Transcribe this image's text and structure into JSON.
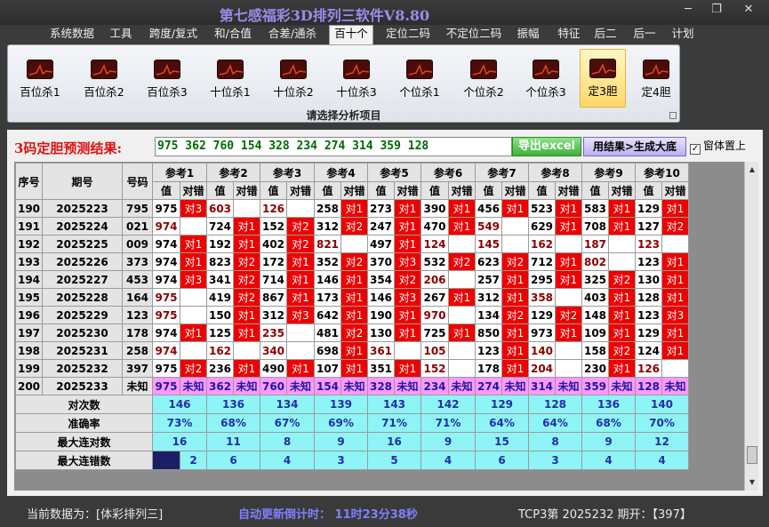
{
  "window": {
    "title": "第七感福彩3D排列三软件V8.80",
    "min": "─",
    "max": "❐",
    "close": "✕"
  },
  "menu": [
    "系统数据",
    "工具",
    "跨度/复式",
    "和/合值",
    "合差/通杀",
    "百十个",
    "定位二码",
    "不定位二码",
    "振幅",
    "特征",
    "后二",
    "后一",
    "计划"
  ],
  "menu_active": "百十个",
  "ribbon": {
    "items": [
      "百位杀1",
      "百位杀2",
      "百位杀3",
      "十位杀1",
      "十位杀2",
      "十位杀3",
      "个位杀1",
      "个位杀2",
      "个位杀3",
      "定3胆",
      "定4胆"
    ],
    "selected": "定3胆",
    "caption": "请选择分析项目"
  },
  "result": {
    "label": "3码定胆预测结果:",
    "value": "975 362 760 154 328 234 274 314 359 128",
    "excel_btn": "导出excel",
    "gen_btn": "用结果>生成大底",
    "pin_label": "窗体置上",
    "pin_checked": "✓"
  },
  "table": {
    "h_index": "序号",
    "h_period": "期号",
    "h_number": "号码",
    "ref_headers": [
      "参考1",
      "参考2",
      "参考3",
      "参考4",
      "参考5",
      "参考6",
      "参考7",
      "参考8",
      "参考9",
      "参考10"
    ],
    "sub_val": "值",
    "sub_hit": "对错",
    "rows": [
      {
        "i": "190",
        "p": "2025223",
        "n": "795",
        "c": [
          [
            "975",
            "对3"
          ],
          [
            "603",
            ""
          ],
          [
            "126",
            ""
          ],
          [
            "258",
            "对1"
          ],
          [
            "273",
            "对1"
          ],
          [
            "390",
            "对1"
          ],
          [
            "456",
            "对1"
          ],
          [
            "523",
            "对1"
          ],
          [
            "583",
            "对1"
          ],
          [
            "129",
            "对1"
          ]
        ]
      },
      {
        "i": "191",
        "p": "2025224",
        "n": "021",
        "c": [
          [
            "974",
            ""
          ],
          [
            "724",
            "对1"
          ],
          [
            "152",
            "对2"
          ],
          [
            "312",
            "对2"
          ],
          [
            "247",
            "对1"
          ],
          [
            "470",
            "对1"
          ],
          [
            "549",
            ""
          ],
          [
            "629",
            "对1"
          ],
          [
            "708",
            "对1"
          ],
          [
            "127",
            "对2"
          ]
        ]
      },
      {
        "i": "192",
        "p": "2025225",
        "n": "009",
        "c": [
          [
            "974",
            "对1"
          ],
          [
            "192",
            "对1"
          ],
          [
            "402",
            "对2"
          ],
          [
            "821",
            ""
          ],
          [
            "497",
            "对1"
          ],
          [
            "124",
            ""
          ],
          [
            "145",
            ""
          ],
          [
            "162",
            ""
          ],
          [
            "187",
            ""
          ],
          [
            "123",
            ""
          ]
        ]
      },
      {
        "i": "193",
        "p": "2025226",
        "n": "373",
        "c": [
          [
            "974",
            "对1"
          ],
          [
            "823",
            "对2"
          ],
          [
            "172",
            "对1"
          ],
          [
            "352",
            "对2"
          ],
          [
            "370",
            "对3"
          ],
          [
            "532",
            "对2"
          ],
          [
            "623",
            "对2"
          ],
          [
            "712",
            "对1"
          ],
          [
            "802",
            ""
          ],
          [
            "123",
            "对1"
          ]
        ]
      },
      {
        "i": "194",
        "p": "2025227",
        "n": "453",
        "c": [
          [
            "974",
            "对3"
          ],
          [
            "341",
            "对2"
          ],
          [
            "714",
            "对1"
          ],
          [
            "146",
            "对1"
          ],
          [
            "354",
            "对2"
          ],
          [
            "206",
            ""
          ],
          [
            "257",
            "对1"
          ],
          [
            "295",
            "对1"
          ],
          [
            "325",
            "对2"
          ],
          [
            "130",
            "对1"
          ]
        ]
      },
      {
        "i": "195",
        "p": "2025228",
        "n": "164",
        "c": [
          [
            "975",
            ""
          ],
          [
            "419",
            "对2"
          ],
          [
            "867",
            "对1"
          ],
          [
            "173",
            "对1"
          ],
          [
            "146",
            "对3"
          ],
          [
            "267",
            "对1"
          ],
          [
            "312",
            "对1"
          ],
          [
            "358",
            ""
          ],
          [
            "403",
            "对1"
          ],
          [
            "128",
            "对1"
          ]
        ]
      },
      {
        "i": "196",
        "p": "2025229",
        "n": "123",
        "c": [
          [
            "975",
            ""
          ],
          [
            "150",
            "对1"
          ],
          [
            "312",
            "对3"
          ],
          [
            "642",
            "对1"
          ],
          [
            "190",
            "对1"
          ],
          [
            "970",
            ""
          ],
          [
            "134",
            "对2"
          ],
          [
            "129",
            "对2"
          ],
          [
            "148",
            "对1"
          ],
          [
            "123",
            "对3"
          ]
        ]
      },
      {
        "i": "197",
        "p": "2025230",
        "n": "178",
        "c": [
          [
            "974",
            "对1"
          ],
          [
            "125",
            "对1"
          ],
          [
            "235",
            ""
          ],
          [
            "481",
            "对2"
          ],
          [
            "130",
            "对1"
          ],
          [
            "725",
            "对1"
          ],
          [
            "850",
            "对1"
          ],
          [
            "973",
            "对1"
          ],
          [
            "109",
            "对1"
          ],
          [
            "129",
            "对1"
          ]
        ]
      },
      {
        "i": "198",
        "p": "2025231",
        "n": "258",
        "c": [
          [
            "974",
            ""
          ],
          [
            "162",
            ""
          ],
          [
            "340",
            ""
          ],
          [
            "698",
            "对1"
          ],
          [
            "361",
            ""
          ],
          [
            "105",
            ""
          ],
          [
            "123",
            "对1"
          ],
          [
            "140",
            ""
          ],
          [
            "158",
            "对2"
          ],
          [
            "124",
            "对1"
          ]
        ]
      },
      {
        "i": "199",
        "p": "2025232",
        "n": "397",
        "c": [
          [
            "975",
            "对2"
          ],
          [
            "236",
            "对1"
          ],
          [
            "490",
            "对1"
          ],
          [
            "107",
            "对1"
          ],
          [
            "351",
            "对1"
          ],
          [
            "152",
            ""
          ],
          [
            "178",
            "对1"
          ],
          [
            "204",
            ""
          ],
          [
            "230",
            "对1"
          ],
          [
            "126",
            ""
          ]
        ]
      }
    ],
    "pred": {
      "i": "200",
      "p": "2025233",
      "n": "未知",
      "vals": [
        "975",
        "362",
        "760",
        "154",
        "328",
        "234",
        "274",
        "314",
        "359",
        "128"
      ],
      "unknown": "未知"
    },
    "stats": [
      {
        "label": "对次数",
        "vals": [
          "146",
          "136",
          "134",
          "139",
          "143",
          "142",
          "129",
          "128",
          "136",
          "140"
        ]
      },
      {
        "label": "准确率",
        "vals": [
          "73%",
          "68%",
          "67%",
          "69%",
          "71%",
          "71%",
          "64%",
          "64%",
          "68%",
          "70%"
        ]
      },
      {
        "label": "最大连对数",
        "vals": [
          "16",
          "11",
          "8",
          "9",
          "16",
          "9",
          "15",
          "8",
          "9",
          "12"
        ]
      },
      {
        "label": "最大连错数",
        "vals": [
          "2",
          "6",
          "4",
          "3",
          "5",
          "4",
          "6",
          "3",
          "4",
          "4"
        ]
      }
    ]
  },
  "status": {
    "current": "当前数据为：[体彩排列三]",
    "countdown": "自动更新倒计时： 11时23分38秒",
    "tcp": "TCP3第 2025232 期开：【397】"
  },
  "colors": {
    "hit": "#ee0000",
    "predict_row": "#ff99ff",
    "stats_row": "#8ff4f6",
    "title": "#9a8ce8"
  }
}
